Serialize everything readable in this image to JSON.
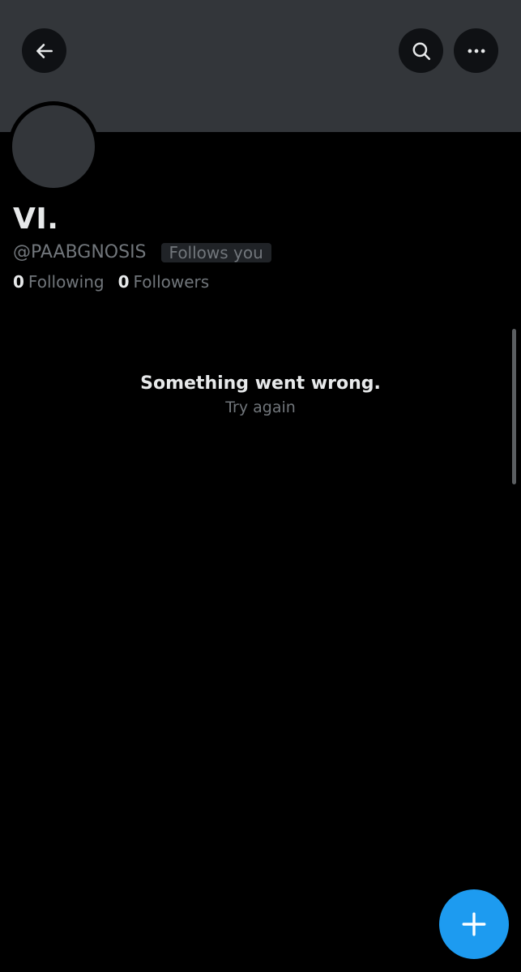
{
  "header": {
    "back_icon": "arrow-left-icon",
    "search_icon": "search-icon",
    "more_icon": "more-horizontal-icon"
  },
  "profile": {
    "display_name": "VI.",
    "handle": "@PAABGNOSIS",
    "follows_you": "Follows you",
    "following_count": "0",
    "following_label": "Following",
    "followers_count": "0",
    "followers_label": "Followers"
  },
  "content": {
    "error_title": "Something went wrong.",
    "retry_label": "Try again"
  },
  "fab": {
    "icon": "plus-icon"
  },
  "colors": {
    "banner": "#33363a",
    "background": "#000000",
    "accent": "#1d9bf0",
    "secondary_text": "#71767b"
  }
}
